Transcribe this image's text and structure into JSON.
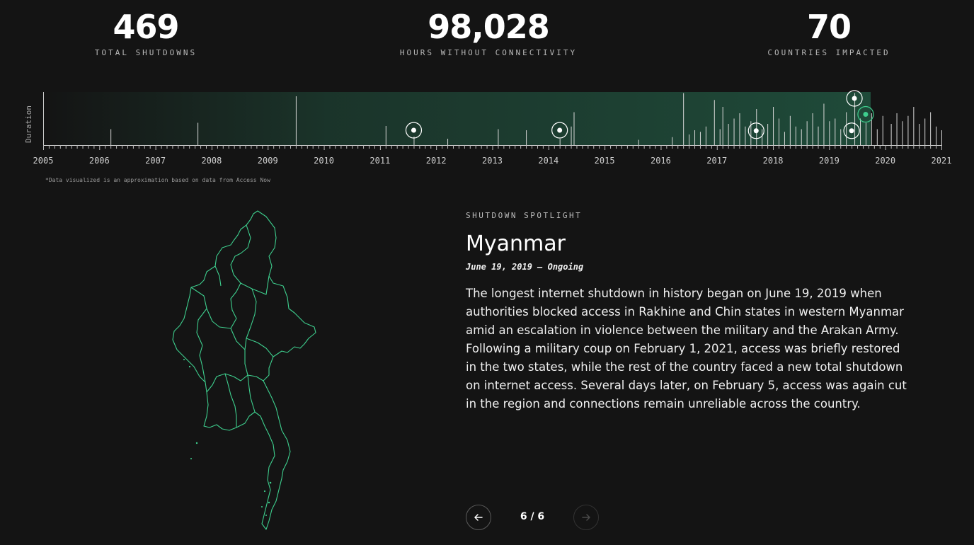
{
  "stats": [
    {
      "value": "469",
      "label": "TOTAL SHUTDOWNS"
    },
    {
      "value": "98,028",
      "label": "HOURS WITHOUT CONNECTIVITY"
    },
    {
      "value": "70",
      "label": "COUNTRIES IMPACTED"
    }
  ],
  "timeline": {
    "y_axis_label": "Duration",
    "years": [
      "2005",
      "2006",
      "2007",
      "2008",
      "2009",
      "2010",
      "2011",
      "2012",
      "2013",
      "2014",
      "2015",
      "2016",
      "2017",
      "2018",
      "2019",
      "2020",
      "2021"
    ],
    "footnote": "*Data visualized is an approximation based on data from Access Now",
    "colors": {
      "accent": "#3ecf8e",
      "bar": "#d8d8d8",
      "band": "#1f4a39"
    },
    "highlighted_years": [
      2011.6,
      2014.2,
      2017.7,
      2019.45,
      2019.4,
      2019.65
    ]
  },
  "chart_data": {
    "type": "bar",
    "x_axis": "year",
    "xlim": [
      2005,
      2021
    ],
    "y_axis": "Duration",
    "bars": [
      [
        2006.2,
        0.3
      ],
      [
        2007.75,
        0.42
      ],
      [
        2009.5,
        0.92
      ],
      [
        2011.1,
        0.36
      ],
      [
        2011.6,
        0.16
      ],
      [
        2012.2,
        0.12
      ],
      [
        2013.1,
        0.3
      ],
      [
        2013.6,
        0.28
      ],
      [
        2014.2,
        0.12
      ],
      [
        2014.4,
        0.35
      ],
      [
        2014.45,
        0.62
      ],
      [
        2015.6,
        0.1
      ],
      [
        2016.2,
        0.15
      ],
      [
        2016.4,
        0.98
      ],
      [
        2016.5,
        0.2
      ],
      [
        2016.6,
        0.28
      ],
      [
        2016.7,
        0.25
      ],
      [
        2016.8,
        0.35
      ],
      [
        2016.95,
        0.85
      ],
      [
        2017.05,
        0.3
      ],
      [
        2017.1,
        0.72
      ],
      [
        2017.2,
        0.4
      ],
      [
        2017.3,
        0.5
      ],
      [
        2017.4,
        0.6
      ],
      [
        2017.5,
        0.35
      ],
      [
        2017.6,
        0.45
      ],
      [
        2017.7,
        0.68
      ],
      [
        2017.8,
        0.3
      ],
      [
        2017.9,
        0.4
      ],
      [
        2018.0,
        0.72
      ],
      [
        2018.1,
        0.5
      ],
      [
        2018.2,
        0.25
      ],
      [
        2018.3,
        0.55
      ],
      [
        2018.4,
        0.35
      ],
      [
        2018.5,
        0.3
      ],
      [
        2018.6,
        0.45
      ],
      [
        2018.7,
        0.6
      ],
      [
        2018.8,
        0.35
      ],
      [
        2018.9,
        0.78
      ],
      [
        2019.0,
        0.45
      ],
      [
        2019.1,
        0.5
      ],
      [
        2019.2,
        0.3
      ],
      [
        2019.3,
        0.62
      ],
      [
        2019.45,
        0.98
      ],
      [
        2019.55,
        0.5
      ],
      [
        2019.65,
        0.42
      ],
      [
        2019.75,
        0.6
      ],
      [
        2019.85,
        0.3
      ],
      [
        2019.95,
        0.55
      ],
      [
        2020.1,
        0.4
      ],
      [
        2020.2,
        0.6
      ],
      [
        2020.3,
        0.45
      ],
      [
        2020.4,
        0.55
      ],
      [
        2020.5,
        0.72
      ],
      [
        2020.6,
        0.4
      ],
      [
        2020.7,
        0.5
      ],
      [
        2020.8,
        0.62
      ],
      [
        2020.9,
        0.35
      ],
      [
        2021.0,
        0.28
      ]
    ]
  },
  "spotlight": {
    "eyebrow": "SHUTDOWN SPOTLIGHT",
    "country": "Myanmar",
    "dates": "June 19, 2019 – Ongoing",
    "description": "The longest internet shutdown in history began on June 19, 2019 when authorities blocked access in Rakhine and Chin states in western Myanmar amid an escalation in violence between the military and the Arakan Army. Following a military coup on February 1, 2021, access was briefly restored in the two states, while the rest of the country faced a new total shutdown on internet access. Several days later, on February 5, access was again cut in the region and connections remain unreliable across the country.",
    "map_color": "#3ecf8e"
  },
  "pager": {
    "text": "6 / 6",
    "prev_icon": "arrow-left-icon",
    "next_icon": "arrow-right-icon"
  }
}
